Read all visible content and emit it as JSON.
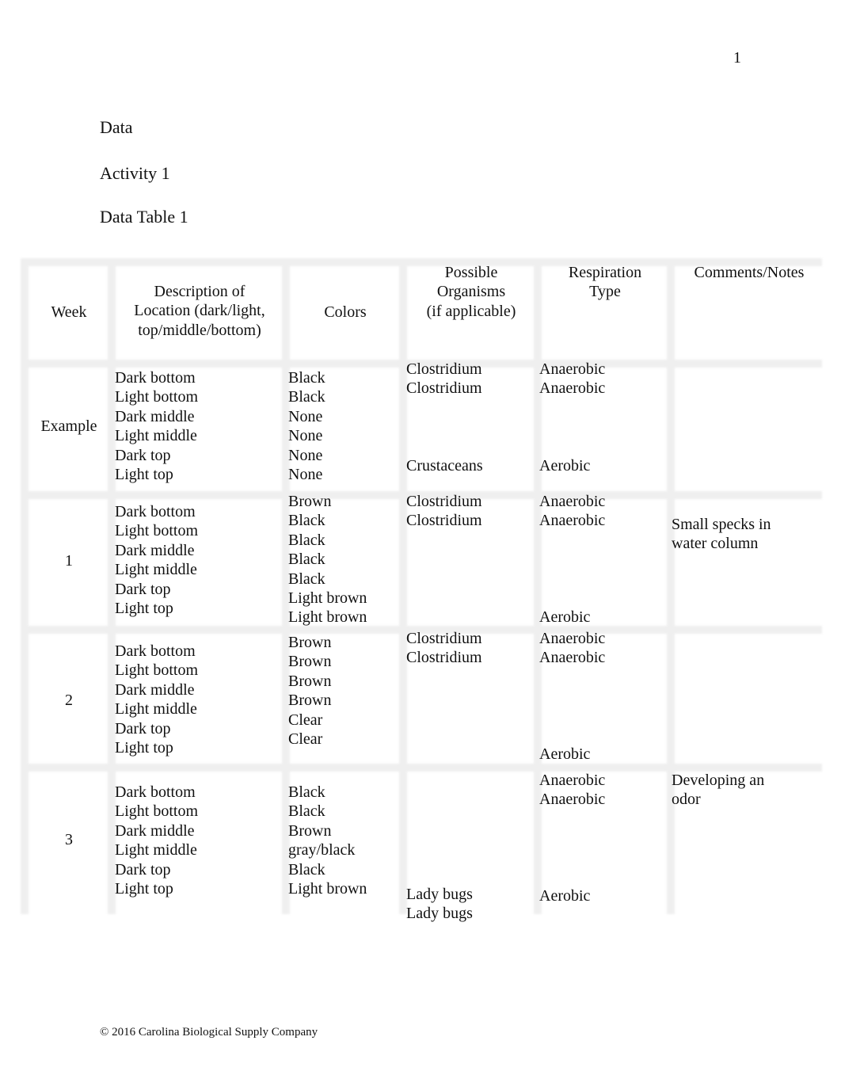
{
  "page_number": "1",
  "headings": {
    "section": "Data",
    "activity": "Activity 1",
    "table_title": "Data Table 1"
  },
  "table": {
    "headers": [
      [
        "Week"
      ],
      [
        "Description of",
        "Location (dark/light,",
        "top/middle/bottom)"
      ],
      [
        "Colors"
      ],
      [
        "Possible",
        "Organisms",
        "(if applicable)"
      ],
      [
        "Respiration",
        "Type"
      ],
      [
        "Comments/Notes"
      ]
    ],
    "rows": [
      {
        "week": "Example",
        "locations": [
          "Dark bottom",
          "Light bottom",
          "Dark middle",
          "Light middle",
          "Dark top",
          "Light top"
        ],
        "colors": [
          "Black",
          "Black",
          "None",
          "None",
          "None",
          "None"
        ],
        "organisms": [
          "Clostridium",
          "Clostridium",
          "",
          "",
          "",
          "Crustaceans"
        ],
        "respiration": [
          "Anaerobic",
          "Anaerobic",
          "",
          "",
          "",
          "Aerobic"
        ],
        "comments": [
          "",
          "",
          "",
          "",
          "Small specks in",
          "water column"
        ]
      },
      {
        "week": "1",
        "locations": [
          "Dark bottom",
          "Light bottom",
          "Dark middle",
          "Light middle",
          "Dark top",
          "Light top"
        ],
        "colors": [
          "Brown",
          "Black",
          "Black",
          "Black",
          "Black",
          "Light brown",
          "Light brown"
        ],
        "organisms": [
          "Clostridium",
          "Clostridium"
        ],
        "respiration": [
          "Anaerobic",
          "Anaerobic",
          "",
          "",
          "",
          "",
          "Aerobic"
        ],
        "comments": []
      },
      {
        "week": "2",
        "locations": [
          "Dark bottom",
          "Light bottom",
          "Dark middle",
          "Light middle",
          "Dark top",
          "Light top"
        ],
        "colors": [
          "Brown",
          "Brown",
          "Brown",
          "Brown",
          "Clear",
          "Clear"
        ],
        "organisms": [
          "Clostridium",
          "Clostridium"
        ],
        "respiration": [
          "Anaerobic",
          "Anaerobic",
          "",
          "",
          "",
          "",
          "Aerobic"
        ],
        "comments": []
      },
      {
        "week": "3",
        "locations": [
          "Dark bottom",
          "Light bottom",
          "Dark middle",
          "Light middle",
          "Dark top",
          "Light top"
        ],
        "colors": [
          "Black",
          "Black",
          "Brown",
          "gray/black",
          "Black",
          "Light brown"
        ],
        "organisms": [
          "",
          "",
          "",
          "",
          "",
          "Lady bugs",
          "Lady bugs"
        ],
        "respiration": [
          "Anaerobic",
          "Anaerobic",
          "",
          "",
          "",
          "",
          "Aerobic"
        ],
        "comments": [
          "Developing an",
          "odor"
        ]
      }
    ]
  },
  "footer": "© 2016 Carolina Biological Supply Company"
}
